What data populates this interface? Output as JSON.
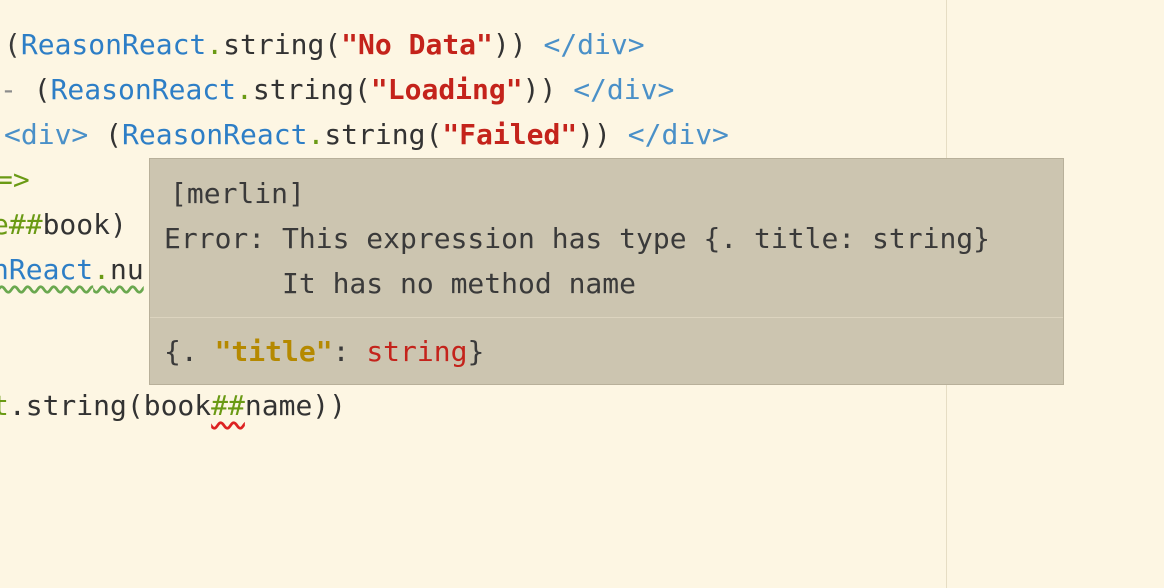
{
  "code": {
    "line1": {
      "prefix": "(",
      "module": "ReasonReact",
      "dot": ".",
      "fn": "string(",
      "str": "\"No Data\"",
      "suffix": ")) ",
      "close_tag": "</div>"
    },
    "line2": {
      "lead": "- ",
      "open": "(",
      "module": "ReasonReact",
      "dot": ".",
      "fn": "string(",
      "str": "\"Loading\"",
      "suffix": ")) ",
      "close_tag": "</div>"
    },
    "line3": {
      "open_tag": "<div>",
      "sp": " (",
      "module": "ReasonReact",
      "dot": ".",
      "fn": "string(",
      "str": "\"Failed\"",
      "suffix": ")) ",
      "close_tag": "</div>"
    },
    "line4": {
      "text": "=>"
    },
    "line5": {
      "op": "e##",
      "text": "book)"
    },
    "line6": {
      "module": "nReact",
      "dot": ".",
      "fn": "nu"
    },
    "line7": {
      "dot": "t",
      "text": ".string(",
      "ident": "book",
      "op": "##",
      "tail": "name))"
    }
  },
  "tooltip": {
    "source": "[merlin]",
    "error_line1": "Error: This expression has type {. title: string}",
    "error_line2": "       It has no method name",
    "type_open": "{. ",
    "type_field": "\"title\"",
    "type_colon": ": ",
    "type_value": "string",
    "type_close": "}"
  }
}
